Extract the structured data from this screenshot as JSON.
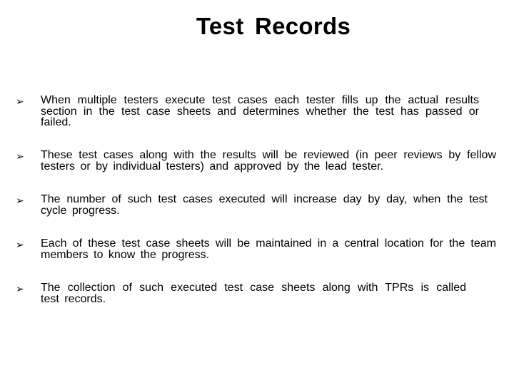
{
  "slide": {
    "title": "Test Records",
    "bullet_icon": "arrowhead-bullet",
    "bullet_glyph": "➢",
    "bullets": [
      {
        "text": "When multiple testers execute test cases each tester fills up the actual results section in the test case sheets and determines whether the test has passed or failed."
      },
      {
        "text": "These test cases along with the results will be reviewed (in peer reviews by fellow testers or by individual testers) and approved by the lead tester."
      },
      {
        "text": "The number of such test cases executed will increase day by day, when the test cycle progress."
      },
      {
        "text": "Each of these test case sheets will be maintained in a central location for the team members to know the progress."
      },
      {
        "text": "The collection of such executed test case sheets along with TPRs is called test records."
      }
    ]
  }
}
